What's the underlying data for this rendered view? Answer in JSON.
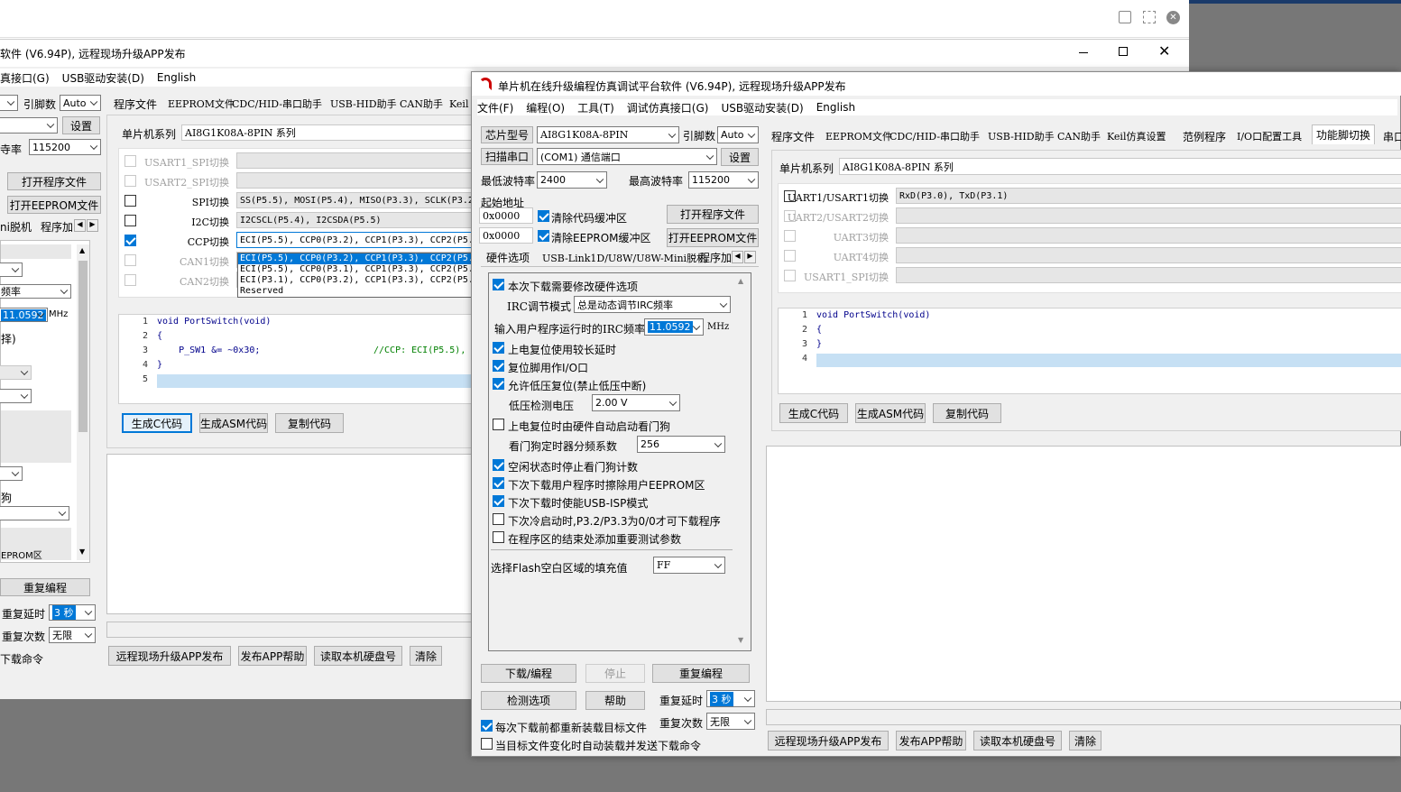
{
  "viewer": {
    "bg": "#ffffff"
  },
  "back": {
    "title": "软件 (V6.94P), 远程现场升级APP发布",
    "menu": [
      "真接口(G)",
      "USB驱动安装(D)",
      "English"
    ],
    "pins_label": "引脚数",
    "pins_value": "Auto",
    "settings": "设置",
    "baud_label": "寺率",
    "baud_value": "115200",
    "open_program": "打开程序文件",
    "open_eeprom": "打开EEPROM文件",
    "left_tabs": [
      "ni脱机",
      "程序加"
    ],
    "irc_value": "11.0592",
    "irc_unit": "MHz",
    "freq_label": "频率",
    "choose_label": "择)",
    "dog_label": "狗",
    "eeprom_label": "EPROM区",
    "reprog": "重复编程",
    "delay_label": "重复延时",
    "delay_value": "3 秒",
    "count_label": "重复次数",
    "count_value": "无限",
    "download_cmd": "下载命令",
    "tabs": [
      "程序文件",
      "EEPROM文件",
      "CDC/HID-串口助手",
      "USB-HID助手",
      "CAN助手",
      "Keil"
    ],
    "series_label": "单片机系列",
    "series_value": "AI8G1K08A-8PIN 系列",
    "rows": [
      {
        "label": "USART1_SPI切换",
        "value": "",
        "enabled": false,
        "checked": false
      },
      {
        "label": "USART2_SPI切换",
        "value": "",
        "enabled": false,
        "checked": false
      },
      {
        "label": "SPI切换",
        "value": "SS(P5.5), MOSI(P5.4), MISO(P3.3), SCLK(P3.2",
        "enabled": true,
        "checked": false
      },
      {
        "label": "I2C切换",
        "value": "I2CSCL(P5.4), I2CSDA(P5.5)",
        "enabled": true,
        "checked": false
      },
      {
        "label": "CCP切换",
        "value": "ECI(P5.5), CCP0(P3.2), CCP1(P3.3), CCP2(P5.",
        "enabled": true,
        "checked": true
      },
      {
        "label": "CAN1切换",
        "value": "",
        "enabled": false,
        "checked": false
      },
      {
        "label": "CAN2切换",
        "value": "",
        "enabled": false,
        "checked": false
      }
    ],
    "dropdown": [
      "ECI(P5.5), CCP0(P3.2), CCP1(P3.3), CCP2(P5.",
      "ECI(P5.5), CCP0(P3.1), CCP1(P3.3), CCP2(P5.",
      "ECI(P3.1), CCP0(P3.2), CCP1(P3.3), CCP2(P5.",
      "Reserved"
    ],
    "code": [
      {
        "n": "1",
        "t": "void PortSwitch(void)"
      },
      {
        "n": "2",
        "t": "{"
      },
      {
        "n": "3",
        "t": "    P_SW1 &= ~0x30;"
      },
      {
        "n": "4",
        "t": "}"
      },
      {
        "n": "5",
        "t": ""
      }
    ],
    "code_comment": "//CCP: ECI(P5.5),",
    "gen_c": "生成C代码",
    "gen_asm": "生成ASM代码",
    "copy": "复制代码",
    "bottom": [
      "远程现场升级APP发布",
      "发布APP帮助",
      "读取本机硬盘号",
      "清除"
    ]
  },
  "front": {
    "title": "单片机在线升级编程仿真调试平台软件 (V6.94P), 远程现场升级APP发布",
    "menu": [
      "文件(F)",
      "编程(O)",
      "工具(T)",
      "调试仿真接口(G)",
      "USB驱动安装(D)",
      "English"
    ],
    "chip_btn": "芯片型号",
    "chip_value": "AI8G1K08A-8PIN",
    "pins_label": "引脚数",
    "pins_value": "Auto",
    "scan_btn": "扫描串口",
    "port_value": "(COM1) 通信端口",
    "settings": "设置",
    "min_baud_label": "最低波特率",
    "min_baud": "2400",
    "max_baud_label": "最高波特率",
    "max_baud": "115200",
    "start_addr_label": "起始地址",
    "addr1": "0x0000",
    "addr2": "0x0000",
    "clear_code": "清除代码缓冲区",
    "clear_eeprom": "清除EEPROM缓冲区",
    "open_program": "打开程序文件",
    "open_eeprom": "打开EEPROM文件",
    "hw_tabs": [
      "硬件选项",
      "USB-Link1D/U8W/U8W-Mini脱机",
      "程序加"
    ],
    "opts": {
      "modify": "本次下载需要修改硬件选项",
      "irc_mode_label": "IRC调节模式",
      "irc_mode_value": "总是动态调节IRC频率",
      "irc_freq_label": "输入用户程序运行时的IRC频率",
      "irc_freq_value": "11.0592",
      "irc_unit": "MHz",
      "long_delay": "上电复位使用较长延时",
      "reset_io": "复位脚用作I/O口",
      "lvr": "允许低压复位(禁止低压中断)",
      "lvd_label": "低压检测电压",
      "lvd_value": "2.00 V",
      "wdt_hw": "上电复位时由硬件自动启动看门狗",
      "wdt_div_label": "看门狗定时器分频系数",
      "wdt_div_value": "256",
      "idle_wdt": "空闲状态时停止看门狗计数",
      "erase_eeprom": "下次下载用户程序时擦除用户EEPROM区",
      "usb_isp": "下次下载时使能USB-ISP模式",
      "p32": "下次冷启动时,P3.2/P3.3为0/0才可下载程序",
      "add_params": "在程序区的结束处添加重要测试参数",
      "fill_label": "选择Flash空白区域的填充值",
      "fill_value": "FF"
    },
    "download": "下载/编程",
    "stop": "停止",
    "reprog": "重复编程",
    "check": "检测选项",
    "help": "帮助",
    "delay_label": "重复延时",
    "delay_value": "3 秒",
    "count_label": "重复次数",
    "count_value": "无限",
    "reload": "每次下载前都重新装载目标文件",
    "auto_send": "当目标文件变化时自动装载并发送下载命令",
    "tabs": [
      "程序文件",
      "EEPROM文件",
      "CDC/HID-串口助手",
      "USB-HID助手",
      "CAN助手",
      "Keil仿真设置",
      "范例程序",
      "I/O口配置工具",
      "功能脚切换",
      "串口"
    ],
    "series_label": "单片机系列",
    "series_value": "AI8G1K08A-8PIN 系列",
    "rows": [
      {
        "label": "UART1/USART1切换",
        "value": "RxD(P3.0), TxD(P3.1)",
        "enabled": true,
        "checked": false
      },
      {
        "label": "UART2/USART2切换",
        "value": "",
        "enabled": false,
        "checked": false
      },
      {
        "label": "UART3切换",
        "value": "",
        "enabled": false,
        "checked": false
      },
      {
        "label": "UART4切换",
        "value": "",
        "enabled": false,
        "checked": false
      },
      {
        "label": "USART1_SPI切换",
        "value": "",
        "enabled": false,
        "checked": false
      }
    ],
    "code": [
      {
        "n": "1",
        "t": "void PortSwitch(void)"
      },
      {
        "n": "2",
        "t": "{"
      },
      {
        "n": "3",
        "t": "}"
      },
      {
        "n": "4",
        "t": ""
      }
    ],
    "gen_c": "生成C代码",
    "gen_asm": "生成ASM代码",
    "copy": "复制代码",
    "bottom": [
      "远程现场升级APP发布",
      "发布APP帮助",
      "读取本机硬盘号",
      "清除"
    ]
  }
}
